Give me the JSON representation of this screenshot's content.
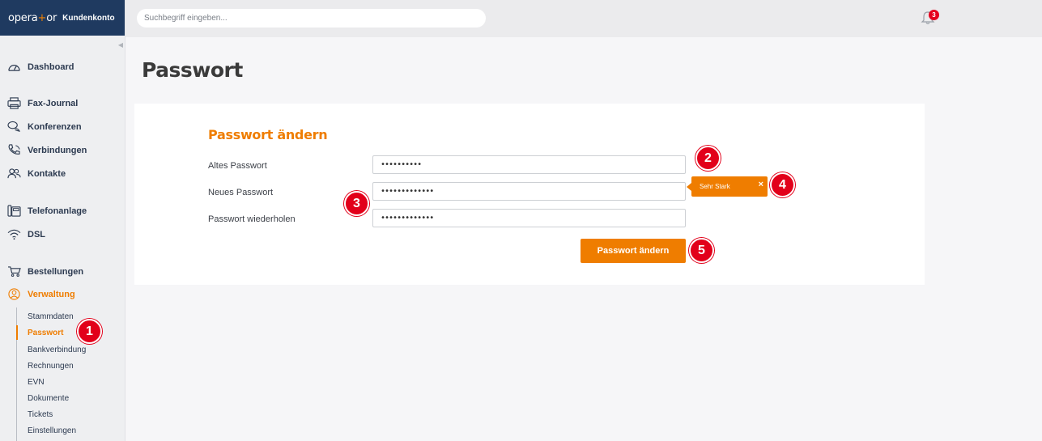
{
  "brand": {
    "logo_left": "opera",
    "logo_plus": "+",
    "logo_right": "or",
    "account": "Kundenkonto"
  },
  "header": {
    "search_placeholder": "Suchbegriff eingeben...",
    "notification_count": "3"
  },
  "sidebar": {
    "items": [
      {
        "label": "Dashboard",
        "icon": "gauge-icon"
      },
      {
        "label": "Fax-Journal",
        "icon": "printer-icon"
      },
      {
        "label": "Konferenzen",
        "icon": "chat-icon"
      },
      {
        "label": "Verbindungen",
        "icon": "phone-icon"
      },
      {
        "label": "Kontakte",
        "icon": "contacts-icon"
      },
      {
        "label": "Telefonanlage",
        "icon": "phone-system-icon"
      },
      {
        "label": "DSL",
        "icon": "wifi-icon"
      },
      {
        "label": "Bestellungen",
        "icon": "cart-icon"
      },
      {
        "label": "Verwaltung",
        "icon": "user-circle-icon"
      }
    ],
    "subitems": [
      {
        "label": "Stammdaten"
      },
      {
        "label": "Passwort"
      },
      {
        "label": "Bankverbindung"
      },
      {
        "label": "Rechnungen"
      },
      {
        "label": "EVN"
      },
      {
        "label": "Dokumente"
      },
      {
        "label": "Tickets"
      },
      {
        "label": "Einstellungen"
      }
    ]
  },
  "page": {
    "title": "Passwort",
    "card_title": "Passwort ändern",
    "fields": [
      {
        "label": "Altes Passwort",
        "value": "••••••••••"
      },
      {
        "label": "Neues Passwort",
        "value": "•••••••••••••"
      },
      {
        "label": "Passwort wiederholen",
        "value": "•••••••••••••"
      }
    ],
    "submit_label": "Passwort ändern",
    "strength_tooltip": "Sehr Stark",
    "tooltip_close": "×"
  },
  "markers": [
    "1",
    "2",
    "3",
    "4",
    "5"
  ],
  "colors": {
    "accent": "#ef7d00",
    "brand_bar": "#1f3a60",
    "marker": "#e2001a"
  }
}
